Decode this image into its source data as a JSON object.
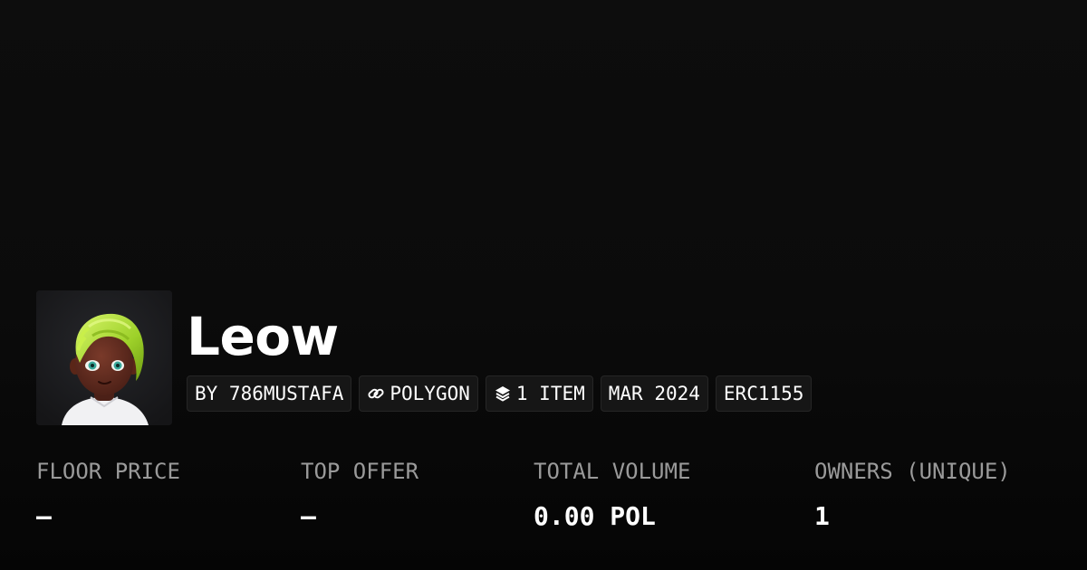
{
  "collection": {
    "name": "Leow"
  },
  "tags": {
    "creator": "BY 786MUSTAFA",
    "chain": "POLYGON",
    "chain_icon": "link-icon",
    "items": "1 ITEM",
    "items_icon": "layers-icon",
    "date": "MAR 2024",
    "standard": "ERC1155"
  },
  "stats": [
    {
      "label": "FLOOR PRICE",
      "value": "–"
    },
    {
      "label": "TOP OFFER",
      "value": "–"
    },
    {
      "label": "TOTAL VOLUME",
      "value": "0.00 POL"
    },
    {
      "label": "OWNERS (UNIQUE)",
      "value": "1"
    }
  ],
  "colors": {
    "background": "#0b0b0b",
    "text": "#ffffff",
    "label": "#9a9a9a",
    "tag_bg": "#161616",
    "avatar_hair": "#a6e22e"
  }
}
